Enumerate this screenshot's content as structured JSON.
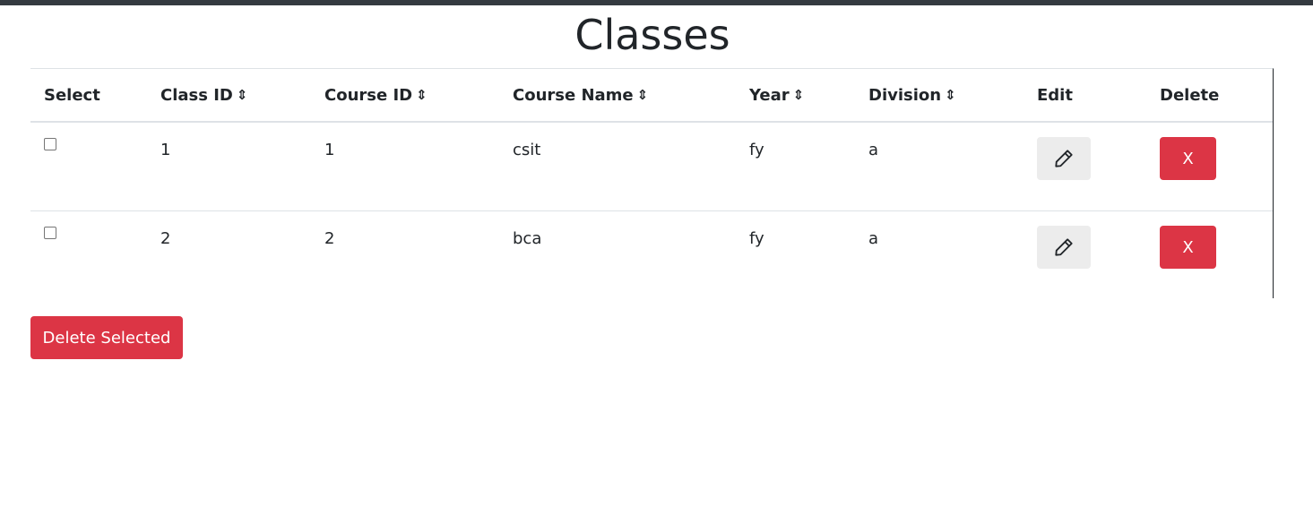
{
  "page": {
    "title": "Classes"
  },
  "table": {
    "headers": {
      "select": "Select",
      "class_id": "Class ID",
      "course_id": "Course ID",
      "course_name": "Course Name",
      "year": "Year",
      "division": "Division",
      "edit": "Edit",
      "delete": "Delete"
    },
    "sort_icon": "⇕",
    "rows": [
      {
        "class_id": "1",
        "course_id": "1",
        "course_name": "csit",
        "year": "fy",
        "division": "a",
        "checked": false,
        "delete_label": "X"
      },
      {
        "class_id": "2",
        "course_id": "2",
        "course_name": "bca",
        "year": "fy",
        "division": "a",
        "checked": false,
        "delete_label": "X"
      }
    ]
  },
  "actions": {
    "delete_selected_label": "Delete Selected"
  },
  "icons": {
    "edit": "pencil-icon",
    "sort": "sort-arrows-icon"
  },
  "colors": {
    "danger": "#dc3545",
    "edit_bg": "#ececec",
    "topbar": "#343a40"
  }
}
